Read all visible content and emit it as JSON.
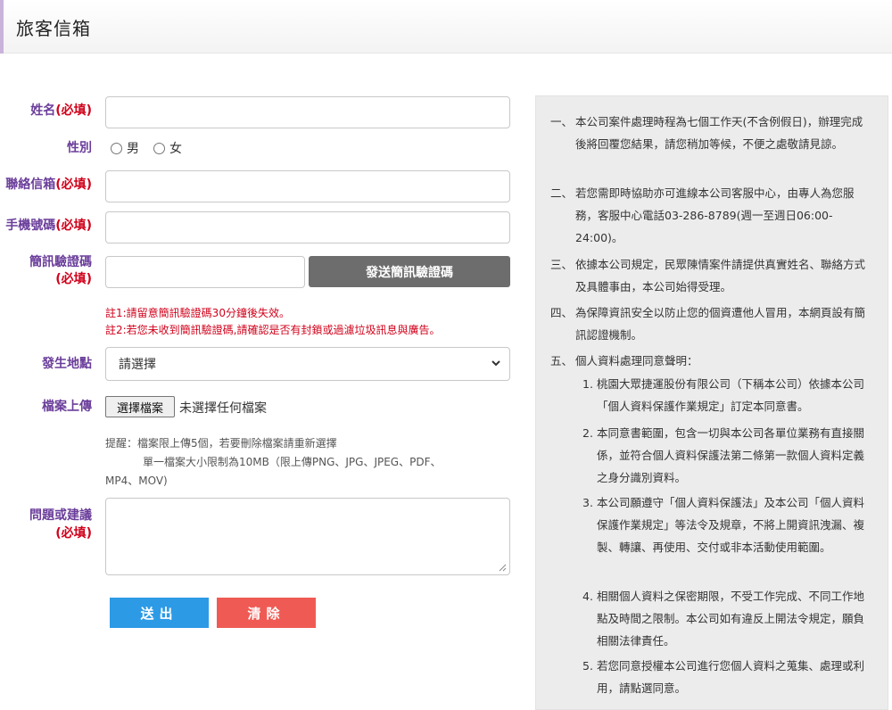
{
  "header": {
    "title": "旅客信箱"
  },
  "form": {
    "name": {
      "label": "姓名",
      "req": "(必填)"
    },
    "gender": {
      "label": "性別",
      "options": [
        "男",
        "女"
      ]
    },
    "email": {
      "label": "聯絡信箱",
      "req": "(必填)"
    },
    "phone": {
      "label": "手機號碼",
      "req": "(必填)"
    },
    "sms": {
      "label": "簡訊驗證碼",
      "req": "(必填)",
      "button": "發送簡訊驗證碼"
    },
    "notes": [
      "註1:請留意簡訊驗證碼30分鐘後失效。",
      "註2:若您未收到簡訊驗證碼,請確認是否有封鎖或過濾垃圾訊息與廣告。"
    ],
    "location": {
      "label": "發生地點",
      "selected": "請選擇"
    },
    "upload": {
      "label": "檔案上傳",
      "button": "選擇檔案",
      "status": "未選擇任何檔案",
      "tips": [
        "提醒：檔案限上傳5個，若要刪除檔案請重新選擇",
        "單一檔案大小限制為10MB（限上傳PNG、JPG、JPEG、PDF、",
        "MP4、MOV)"
      ]
    },
    "question": {
      "label": "問題或建議",
      "req": "(必填)"
    },
    "submit": "送出",
    "clear": "清除"
  },
  "panel": {
    "items": [
      {
        "num": "一、",
        "text": "本公司案件處理時程為七個工作天(不含例假日)，辦理完成後將回覆您結果，請您稍加等候，不便之處敬請見諒。"
      },
      {
        "num": "二、",
        "text": "若您需即時協助亦可進線本公司客服中心，由專人為您服務，客服中心電話03-286-8789(週一至週日06:00-24:00)。"
      },
      {
        "num": "三、",
        "text": "依據本公司規定，民眾陳情案件請提供真實姓名、聯絡方式及具體事由，本公司始得受理。"
      },
      {
        "num": "四、",
        "text": "為保障資訊安全以防止您的個資遭他人冒用，本網頁設有簡訊認證機制。"
      },
      {
        "num": "五、",
        "text": "個人資料處理同意聲明："
      }
    ],
    "sub_items": [
      {
        "num": "1.",
        "text": "桃園大眾捷運股份有限公司（下稱本公司）依據本公司「個人資料保護作業規定」訂定本同意書。"
      },
      {
        "num": "2.",
        "text": "本同意書範圍，包含一切與本公司各單位業務有直接關係，並符合個人資料保護法第二條第一款個人資料定義之身分識別資料。"
      },
      {
        "num": "3.",
        "text": "本公司願遵守「個人資料保護法」及本公司「個人資料保護作業規定」等法令及規章，不將上開資訊洩漏、複製、轉讓、再使用、交付或非本活動使用範圍。"
      },
      {
        "num": "4.",
        "text": "相關個人資料之保密期限，不受工作完成、不同工作地點及時間之限制。本公司如有違反上開法令規定，願負相關法律責任。"
      },
      {
        "num": "5.",
        "text": "若您同意授權本公司進行您個人資料之蒐集、處理或利用，請點選同意。"
      }
    ]
  }
}
